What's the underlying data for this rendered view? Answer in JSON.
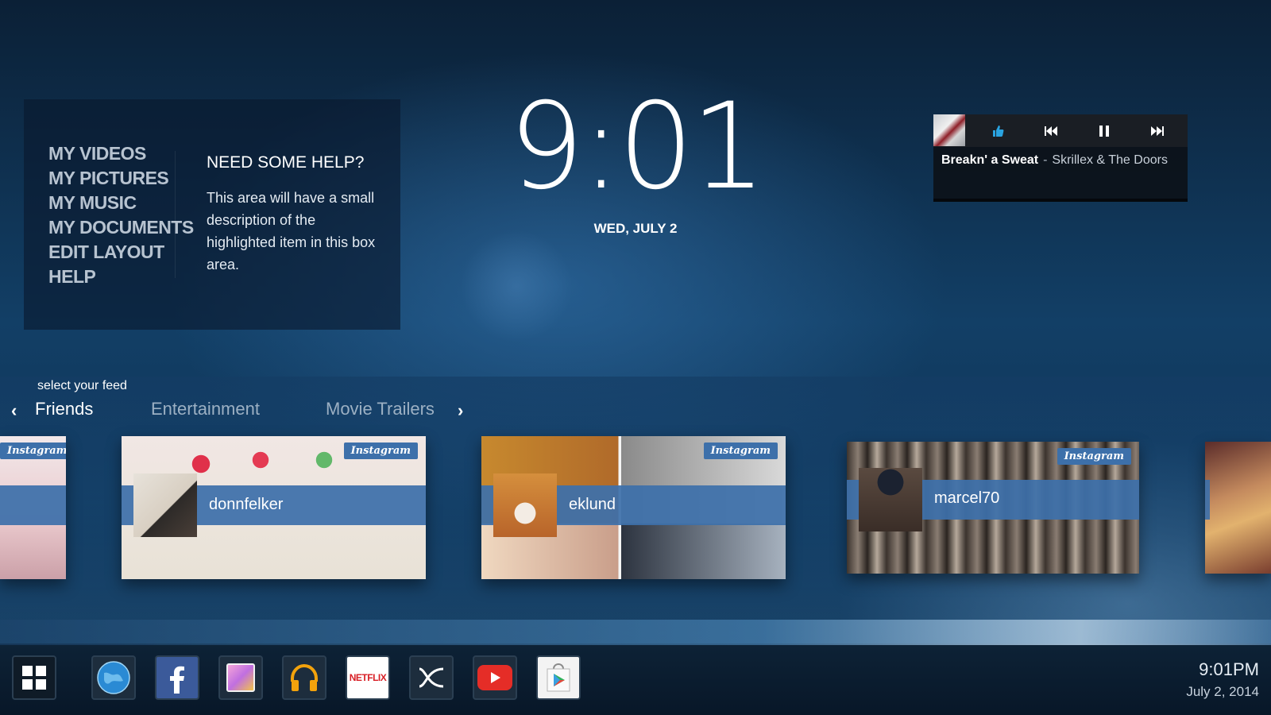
{
  "menu": {
    "items": [
      "My Videos",
      "My Pictures",
      "My Music",
      "My Documents",
      "Edit Layout",
      "Help"
    ]
  },
  "help": {
    "title": "NEED SOME HELP?",
    "description": "This area will have a small description of the highlighted item in this box area."
  },
  "clock": {
    "time": "9:01",
    "date": "WED, JULY 2"
  },
  "player": {
    "track_title": "Breakn' a Sweat",
    "separator": "-",
    "artist": "Skrillex & The Doors",
    "controls": [
      "thumbs-up-icon",
      "previous-icon",
      "pause-icon",
      "next-icon"
    ]
  },
  "feed": {
    "heading": "select your feed",
    "tabs": [
      "Friends",
      "Entertainment",
      "Movie Trailers"
    ],
    "active_tab": "Friends",
    "cards": [
      {
        "source": "Instagram",
        "name": ""
      },
      {
        "source": "Instagram",
        "name": "donnfelker"
      },
      {
        "source": "Instagram",
        "name": "eklund"
      },
      {
        "source": "Instagram",
        "name": "marcel70"
      }
    ]
  },
  "taskbar": {
    "apps": [
      "apps-grid",
      "browser",
      "facebook",
      "gallery",
      "music",
      "netflix",
      "plex",
      "youtube",
      "play-store"
    ],
    "netflix_label": "NETFLIX",
    "time": "9:01PM",
    "date": "July 2, 2014"
  },
  "colors": {
    "accent": "#3d70aa",
    "background": "#123f66",
    "inactive_tab": "#9cb0c3"
  }
}
